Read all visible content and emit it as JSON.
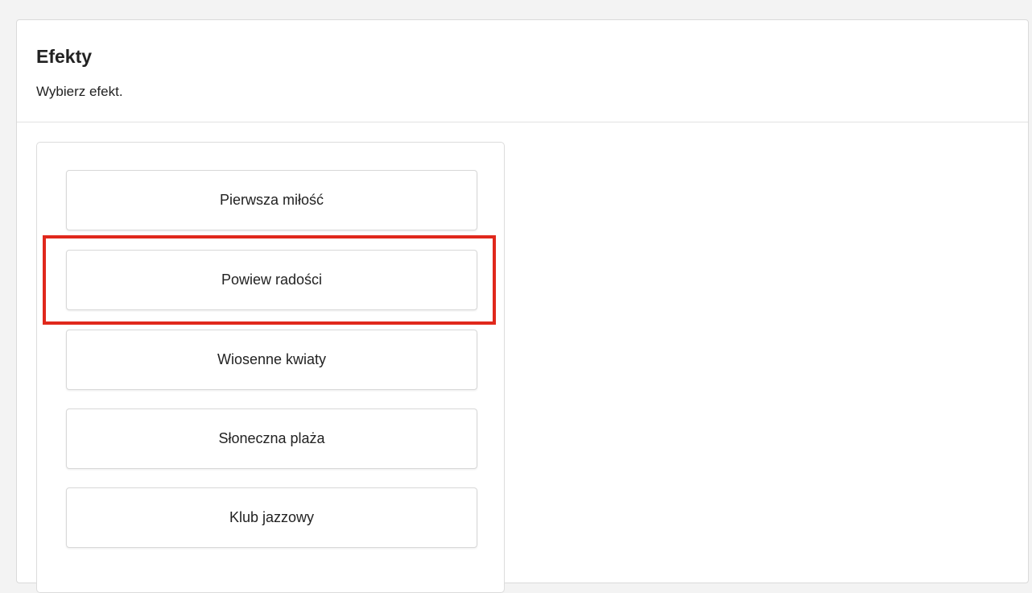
{
  "panel": {
    "title": "Efekty",
    "subtitle": "Wybierz efekt."
  },
  "effects": [
    {
      "label": "Pierwsza miłość"
    },
    {
      "label": "Powiew radości"
    },
    {
      "label": "Wiosenne kwiaty"
    },
    {
      "label": "Słoneczna plaża"
    },
    {
      "label": "Klub jazzowy"
    }
  ],
  "highlight": {
    "target": "Powiew radości",
    "color": "#e0281c"
  }
}
